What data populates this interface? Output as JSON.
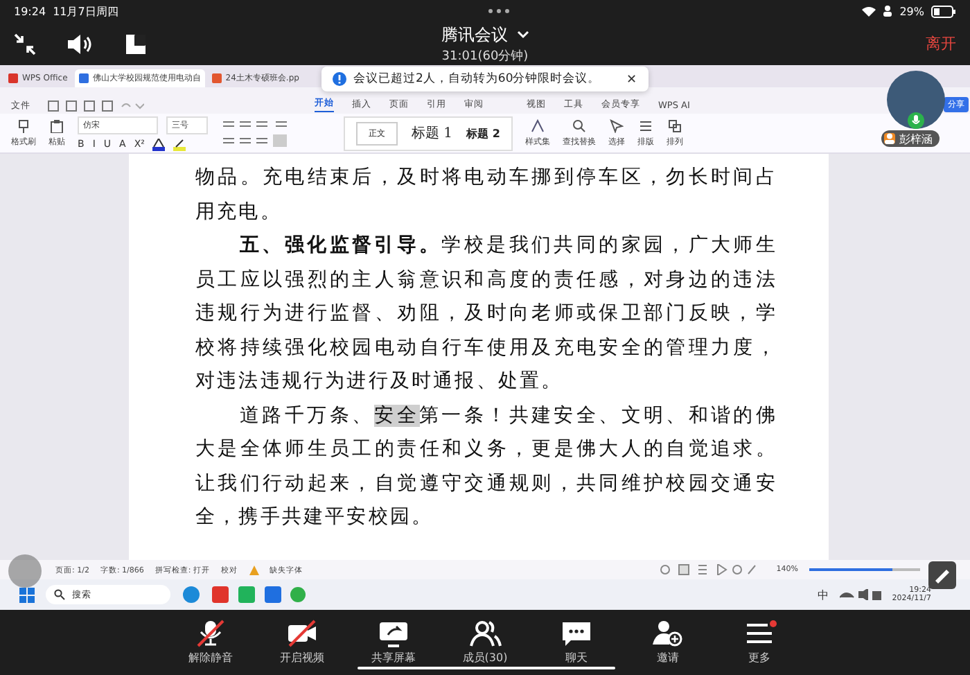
{
  "status_bar": {
    "time": "19:24",
    "date": "11月7日周四",
    "battery": "29%"
  },
  "meeting": {
    "title": "腾讯会议",
    "timer": "31:01(60分钟)",
    "leave": "离开"
  },
  "notice": {
    "text": "会议已超过2人，自动转为60分钟限时会议。",
    "close": "✕"
  },
  "participant": {
    "name": "彭梓涵",
    "speaking": true
  },
  "wps": {
    "tabs": [
      {
        "label": "WPS Office",
        "kind": "home",
        "selected": false
      },
      {
        "label": "佛山大学校园规范使用电动自",
        "kind": "doc",
        "selected": true
      },
      {
        "label": "24土木专硕班会.pp",
        "kind": "ppt",
        "selected": false
      }
    ],
    "file_menu": "文件",
    "ribbon_tabs": [
      {
        "label": "开始",
        "selected": true
      },
      {
        "label": "插入",
        "selected": false
      },
      {
        "label": "页面",
        "selected": false
      },
      {
        "label": "引用",
        "selected": false
      },
      {
        "label": "审阅",
        "selected": false
      },
      {
        "label": "视图",
        "selected": false
      },
      {
        "label": "工具",
        "selected": false
      },
      {
        "label": "会员专享",
        "selected": false
      },
      {
        "label": "WPS AI",
        "selected": false
      }
    ],
    "share": "分享",
    "tools": {
      "format_painter": "格式刷",
      "paste": "粘贴",
      "font": "仿宋",
      "size": "三号",
      "format_keys": [
        "B",
        "I",
        "U",
        "A",
        "X²"
      ],
      "styles": [
        {
          "label": "正文",
          "kind": "body"
        },
        {
          "label": "标题 1",
          "kind": "h1"
        },
        {
          "label": "标题 2",
          "kind": "h2"
        }
      ],
      "style_set": "样式集",
      "find": "查找替换",
      "select": "选择",
      "layout": "排版",
      "arrange": "排列"
    },
    "paragraphs": [
      {
        "indent": false,
        "segments": [
          {
            "text": "物品。充电结束后，及时将电动车挪到停车区，勿长时间占用充电。",
            "kind": "plain"
          }
        ]
      },
      {
        "indent": true,
        "segments": [
          {
            "text": "五、强化监督引导。",
            "kind": "bold"
          },
          {
            "text": "学校是我们共同的家园，广大师生员工应以强烈的主人翁意识和高度的责任感，对身边的违法违规行为进行监督、劝阻，及时向老师或保卫部门反映，学校将持续强化校园电动自行车使用及充电安全的管理力度，对违法违规行为进行及时通报、处置。",
            "kind": "plain"
          }
        ]
      },
      {
        "indent": true,
        "segments": [
          {
            "text": "道路千万条、",
            "kind": "plain"
          },
          {
            "text": "安全",
            "kind": "selected"
          },
          {
            "text": "第一条！共建安全、文明、和谐的佛大是全体师生员工的责任和义务，更是佛大人的自觉追求。让我们行动起来，自觉遵守交通规则，共同维护校园交通安全，携手共建平安校园。",
            "kind": "plain"
          }
        ]
      }
    ],
    "doc_status": {
      "page": "页面: 1/2",
      "words": "字数: 1/866",
      "spell": "拼写检查: 打开",
      "proof": "校对",
      "missing_font": "缺失字体",
      "zoom": "140%",
      "zoom_level": {
        "level": 0.75
      }
    }
  },
  "taskbar": {
    "search": "搜索",
    "ime": "中",
    "time": "19:24",
    "date": "2024/11/7"
  },
  "controls": [
    {
      "label": "解除静音",
      "kind": "mic",
      "off": true,
      "notification": false
    },
    {
      "label": "开启视频",
      "kind": "camera",
      "off": true,
      "notification": false
    },
    {
      "label": "共享屏幕",
      "kind": "share",
      "off": false,
      "notification": false
    },
    {
      "label": "成员(30)",
      "kind": "members",
      "off": false,
      "notification": false
    },
    {
      "label": "聊天",
      "kind": "chat",
      "off": false,
      "notification": false
    },
    {
      "label": "邀请",
      "kind": "invite",
      "off": false,
      "notification": false
    },
    {
      "label": "更多",
      "kind": "more",
      "off": false,
      "notification": true
    }
  ]
}
